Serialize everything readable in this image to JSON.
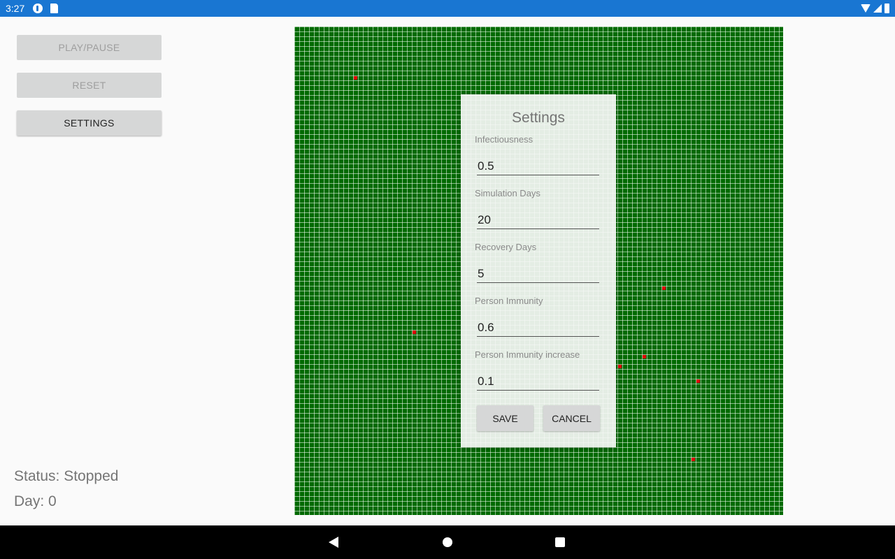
{
  "status_bar": {
    "time": "3:27",
    "left_icons": [
      "notification-p-icon",
      "sd-card-icon"
    ],
    "right_icons": [
      "wifi-icon",
      "signal-icon",
      "battery-icon"
    ]
  },
  "controls": {
    "play_pause_label": "PLAY/PAUSE",
    "reset_label": "RESET",
    "settings_label": "SETTINGS"
  },
  "info": {
    "status": "Status: Stopped",
    "day": "Day: 0"
  },
  "grid": {
    "healthy_color": "#006a00",
    "infected_color": "#e00000"
  },
  "settings_dialog": {
    "title": "Settings",
    "fields": [
      {
        "label": "Infectiousness",
        "value": "0.5"
      },
      {
        "label": "Simulation Days",
        "value": "20"
      },
      {
        "label": "Recovery Days",
        "value": "5"
      },
      {
        "label": "Person Immunity",
        "value": "0.6"
      },
      {
        "label": "Person Immunity increase",
        "value": "0.1"
      }
    ],
    "save_label": "SAVE",
    "cancel_label": "CANCEL"
  },
  "nav_bar": {
    "icons": [
      "back-icon",
      "home-icon",
      "recents-icon"
    ]
  }
}
